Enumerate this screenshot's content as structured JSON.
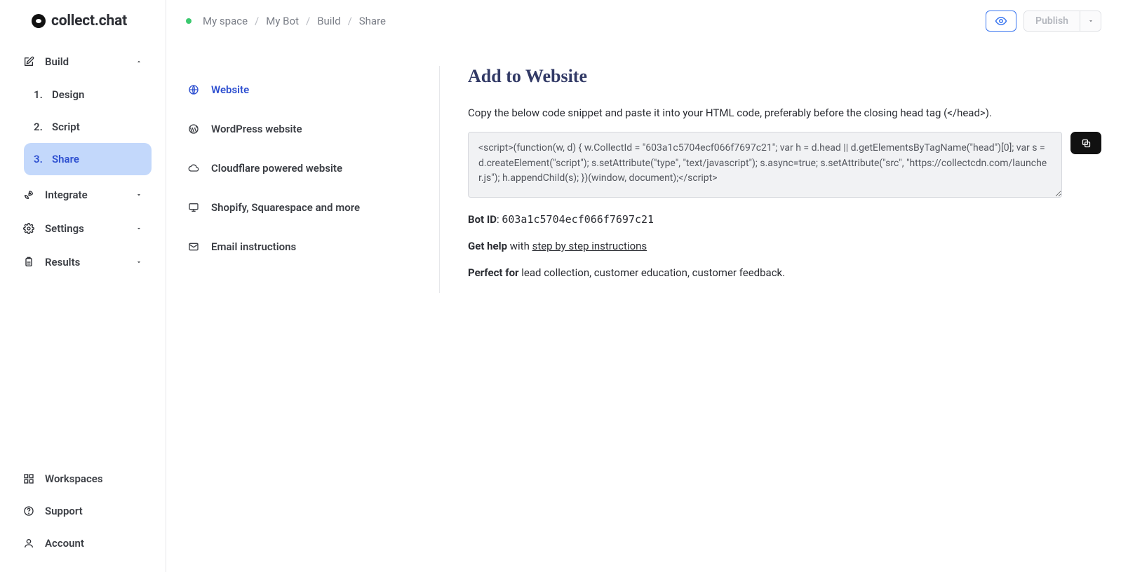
{
  "logo_text": "collect.chat",
  "sidebar": {
    "items": [
      {
        "label": "Build",
        "expanded": true
      },
      {
        "label": "Integrate",
        "expanded": false
      },
      {
        "label": "Settings",
        "expanded": false
      },
      {
        "label": "Results",
        "expanded": false
      }
    ],
    "build_sub": [
      {
        "num": "1.",
        "label": "Design"
      },
      {
        "num": "2.",
        "label": "Script"
      },
      {
        "num": "3.",
        "label": "Share"
      }
    ],
    "footer": [
      {
        "label": "Workspaces"
      },
      {
        "label": "Support"
      },
      {
        "label": "Account"
      }
    ]
  },
  "breadcrumb": [
    "My space",
    "My Bot",
    "Build",
    "Share"
  ],
  "publish_label": "Publish",
  "sublist": [
    "Website",
    "WordPress website",
    "Cloudflare powered website",
    "Shopify, Squarespace and more",
    "Email instructions"
  ],
  "panel": {
    "title": "Add to Website",
    "lead": "Copy the below code snippet and paste it into your HTML code, preferably before the closing head tag (</head>).",
    "code": "<script>(function(w, d) { w.CollectId = \"603a1c5704ecf066f7697c21\"; var h = d.head || d.getElementsByTagName(\"head\")[0]; var s = d.createElement(\"script\"); s.setAttribute(\"type\", \"text/javascript\"); s.async=true; s.setAttribute(\"src\", \"https://collectcdn.com/launcher.js\"); h.appendChild(s); })(window, document);</script>",
    "bot_id_label": "Bot ID",
    "bot_id_value": "603a1c5704ecf066f7697c21",
    "get_help_label": "Get help",
    "get_help_mid": " with ",
    "get_help_link": "step by step instructions",
    "perfect_label": "Perfect for",
    "perfect_text": " lead collection, customer education, customer feedback."
  }
}
